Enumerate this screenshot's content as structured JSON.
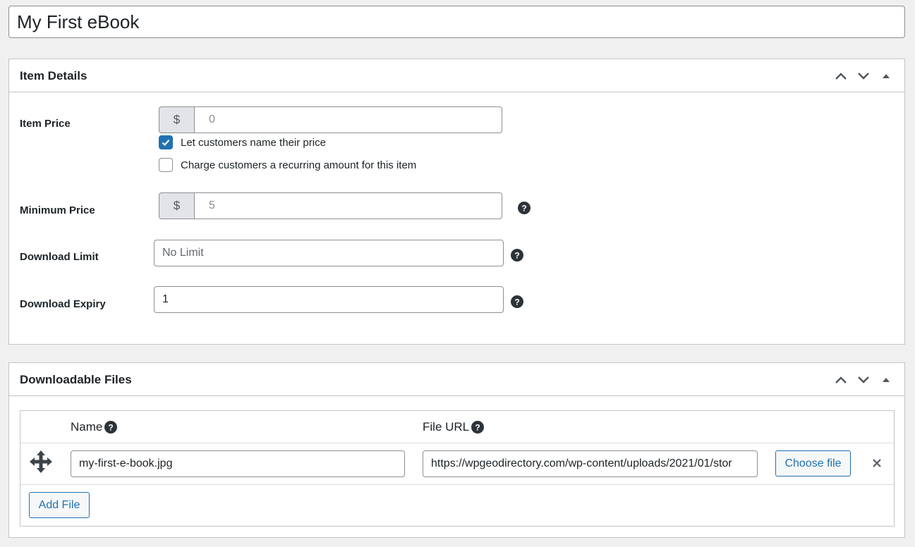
{
  "post_title": "My First eBook",
  "item_details": {
    "title": "Item Details",
    "item_price_label": "Item Price",
    "currency_symbol": "$",
    "item_price_value": "0",
    "name_price_label": "Let customers name their price",
    "name_price_checked": true,
    "recurring_label": "Charge customers a recurring amount for this item",
    "recurring_checked": false,
    "minimum_price_label": "Minimum Price",
    "minimum_price_value": "5",
    "download_limit_label": "Download Limit",
    "download_limit_placeholder": "No Limit",
    "download_expiry_label": "Download Expiry",
    "download_expiry_value": "1"
  },
  "downloadable_files": {
    "title": "Downloadable Files",
    "col_name": "Name",
    "col_url": "File URL",
    "files": [
      {
        "name": "my-first-e-book.jpg",
        "url": "https://wpgeodirectory.com/wp-content/uploads/2021/01/stor"
      }
    ],
    "choose_file_label": "Choose file",
    "add_file_label": "Add File"
  },
  "colors": {
    "accent": "#2271b1",
    "border": "#c3c4c7",
    "background": "#f0f0f1"
  }
}
